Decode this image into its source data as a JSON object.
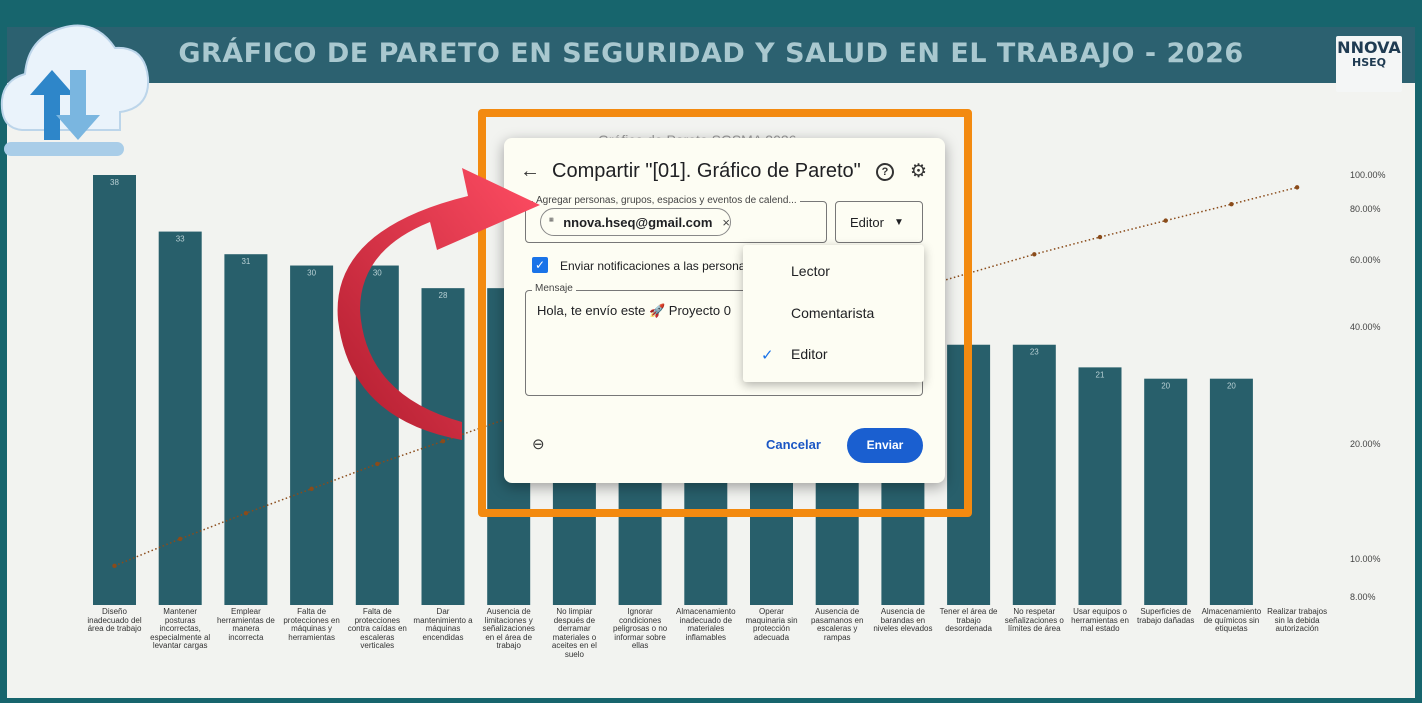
{
  "banner": {
    "title": "GRÁFICO DE PARETO EN SEGURIDAD Y SALUD EN EL TRABAJO - 2026",
    "logo_line1": "NNOVA",
    "logo_line2": "HSEQ"
  },
  "chart_data": {
    "type": "bar",
    "categories": [
      "Diseño inadecuado del área de trabajo",
      "Mantener posturas incorrectas, especialmente al levantar cargas",
      "Emplear herramientas de manera incorrecta",
      "Falta de protecciones en máquinas y herramientas",
      "Falta de protecciones contra caídas en escaleras verticales",
      "Dar mantenimiento a máquinas encendidas",
      "Ausencia de limitaciones y señalizaciones en el área de trabajo",
      "No limpiar después de derramar materiales o aceites en el suelo",
      "Ignorar condiciones peligrosas o no informar sobre ellas",
      "Almacenamiento inadecuado de materiales inflamables",
      "Operar maquinaria sin protección adecuada",
      "Ausencia de pasamanos en escaleras y rampas",
      "Ausencia de barandas en niveles elevados",
      "Tener el área de trabajo desordenada",
      "No respetar señalizaciones o límites de área",
      "Usar equipos o herramientas en mal estado",
      "Superficies de trabajo dañadas",
      "Almacenamiento de químicos sin etiquetas",
      "Realizar trabajos sin la debida autorización"
    ],
    "values": [
      38,
      33,
      31,
      30,
      30,
      28,
      28,
      27,
      27,
      27,
      27,
      23,
      23,
      23,
      23,
      21,
      20,
      20,
      0
    ],
    "visible_value_labels": [
      "38",
      "33",
      "31",
      "30",
      "30",
      "28",
      "",
      "",
      "",
      "",
      "",
      "",
      "",
      "",
      "23",
      "21",
      "20",
      "20",
      ""
    ],
    "cumulative_pct": [
      7.4,
      13.8,
      19.9,
      25.7,
      31.6,
      37.0,
      42.5,
      47.7,
      53.0,
      58.2,
      63.5,
      68.0,
      72.4,
      76.9,
      81.4,
      85.5,
      89.4,
      93.3,
      97.3
    ],
    "y2_ticks": [
      "100.00%",
      "80.00%",
      "60.00%",
      "40.00%",
      "20.00%",
      "10.00%",
      "8.00%"
    ],
    "title": "Gráfico de Pareto SGSMA 2026",
    "bar_color": "#285f6b",
    "line_color": "#8a4b1a"
  },
  "dialog": {
    "back_icon": "arrow-back-icon",
    "title": "Compartir \"[01]. Gráfico de Pareto\"",
    "help_icon_label": "?",
    "people_legend": "Agregar personas, grupos, espacios y eventos de calend...",
    "chip_email": "nnova.hseq@gmail.com",
    "chip_remove": "×",
    "role_selected": "Editor",
    "notify_label": "Enviar notificaciones a las persona",
    "message_legend": "Mensaje",
    "message_text": "Hola, te envío este 🚀 Proyecto 0",
    "cancel_label": "Cancelar",
    "send_label": "Enviar"
  },
  "role_menu": {
    "options": [
      "Lector",
      "Comentarista",
      "Editor"
    ],
    "selected": "Editor"
  },
  "colors": {
    "banner": "#2c6170",
    "frame": "#f38a10",
    "primary": "#1a5fd0",
    "arrow": "#e0243c"
  }
}
